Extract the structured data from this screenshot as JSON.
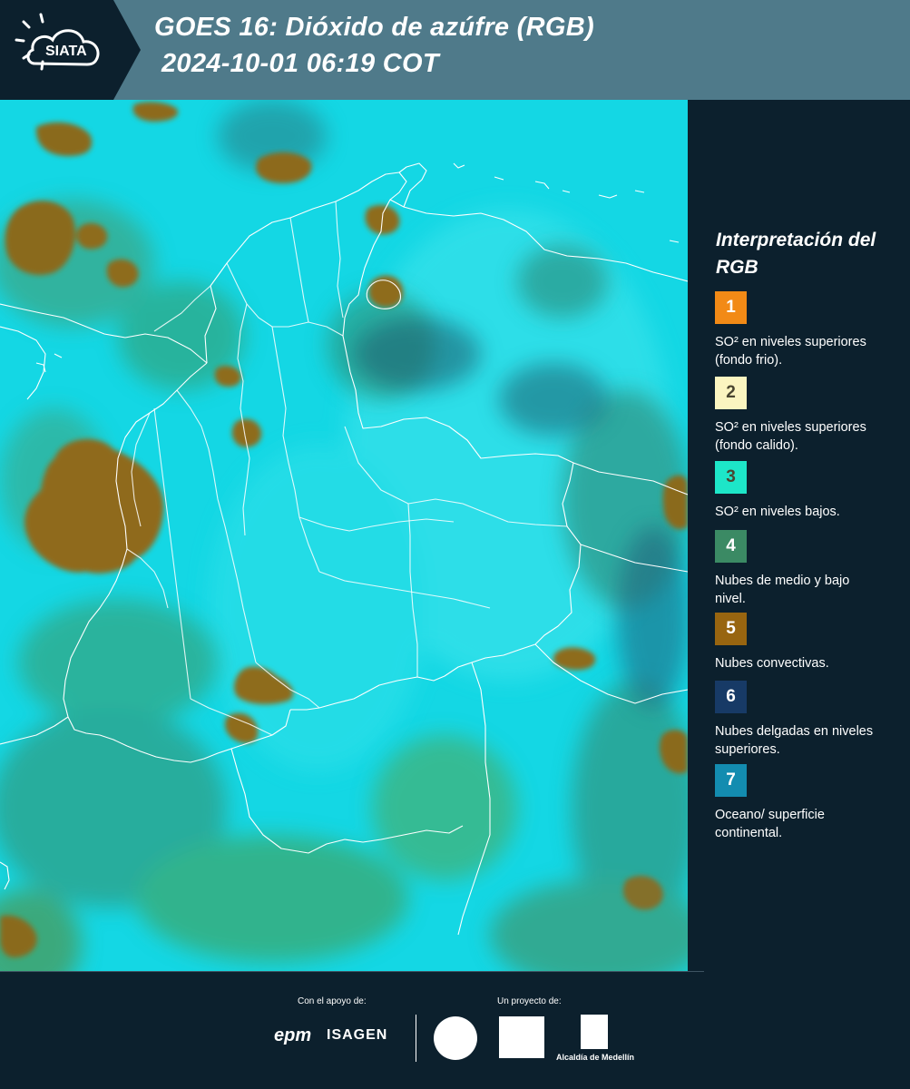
{
  "header": {
    "logo_text": "SIATA",
    "title_line1": "GOES 16: Dióxido de azúfre (RGB)",
    "title_line2": "2024-10-01 06:19 COT"
  },
  "legend": {
    "title": "Interpretación del RGB",
    "items": [
      {
        "number": "1",
        "color": "#f28a16",
        "description": "SO² en niveles superiores (fondo frio)."
      },
      {
        "number": "2",
        "color": "#fbf5c0",
        "description": "SO² en niveles superiores (fondo calido)."
      },
      {
        "number": "3",
        "color": "#1de6c8",
        "description": "SO² en niveles bajos."
      },
      {
        "number": "4",
        "color": "#3b8a64",
        "description": "Nubes de medio y bajo nivel."
      },
      {
        "number": "5",
        "color": "#986510",
        "description": "Nubes convectivas."
      },
      {
        "number": "6",
        "color": "#173a66",
        "description": "Nubes delgadas en niveles superiores."
      },
      {
        "number": "7",
        "color": "#138cb0",
        "description": "Oceano/ superficie continental."
      }
    ]
  },
  "footer": {
    "support_label": "Con el apoyo de:",
    "project_label": "Un proyecto de:",
    "sponsor1": "epm",
    "sponsor2": "ISAGEN",
    "partner_label": "Alcaldía de Medellín"
  },
  "colors": {
    "header_bg": "#4f7a8a",
    "page_bg": "#0c202d",
    "map_cyan": "#14d7e4",
    "convective": "#986510",
    "mid_low_clouds": "#3b8a64"
  }
}
